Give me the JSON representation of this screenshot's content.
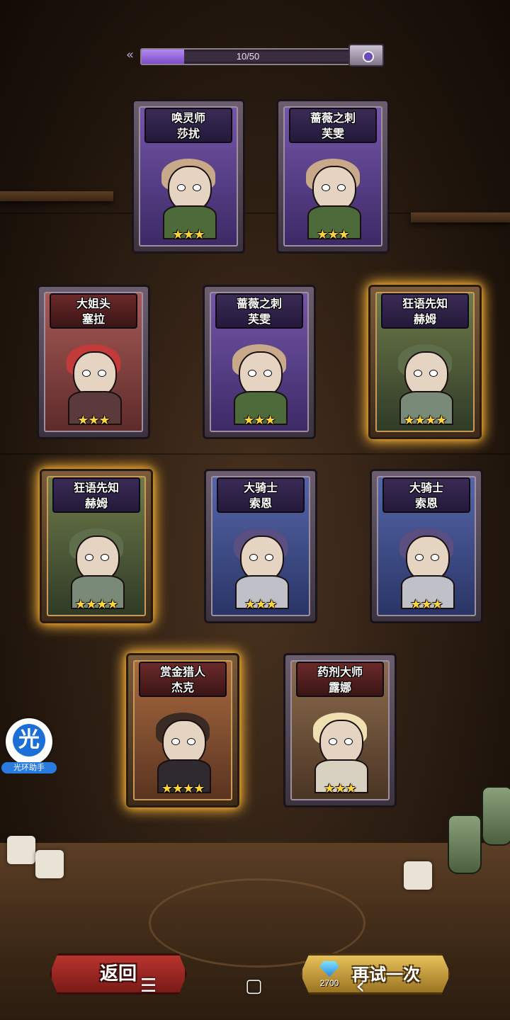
{
  "progress": {
    "text": "10/50",
    "fraction": 0.2
  },
  "cards": [
    {
      "title1": "唤灵师",
      "title2": "莎扰",
      "stars": "★★★",
      "theme": "purple",
      "gold": false
    },
    {
      "title1": "蔷薇之刺",
      "title2": "芙雯",
      "stars": "★★★",
      "theme": "purple",
      "gold": false
    },
    {
      "title1": "大姐头",
      "title2": "塞拉",
      "stars": "★★★",
      "theme": "red",
      "gold": false
    },
    {
      "title1": "蔷薇之刺",
      "title2": "芙雯",
      "stars": "★★★",
      "theme": "purple",
      "gold": false
    },
    {
      "title1": "狂语先知",
      "title2": "赫姆",
      "stars": "★★★★",
      "theme": "green",
      "gold": true
    },
    {
      "title1": "狂语先知",
      "title2": "赫姆",
      "stars": "★★★★",
      "theme": "green",
      "gold": true
    },
    {
      "title1": "大骑士",
      "title2": "索恩",
      "stars": "★★★",
      "theme": "blue",
      "gold": false
    },
    {
      "title1": "大骑士",
      "title2": "索恩",
      "stars": "★★★",
      "theme": "blue",
      "gold": false
    },
    {
      "title1": "赏金猎人",
      "title2": "杰克",
      "stars": "★★★★",
      "theme": "orange",
      "gold": true
    },
    {
      "title1": "药剂大师",
      "title2": "露娜",
      "stars": "★★★",
      "theme": "brown",
      "gold": false
    }
  ],
  "helper": {
    "glyph": "光",
    "label": "光环助手"
  },
  "buttons": {
    "back_label": "返回",
    "retry_label": "再试一次",
    "retry_cost": "2700",
    "cost_icon": "gem-icon"
  },
  "nav": {
    "menu": "☰",
    "home": "▢",
    "back": "‹"
  }
}
